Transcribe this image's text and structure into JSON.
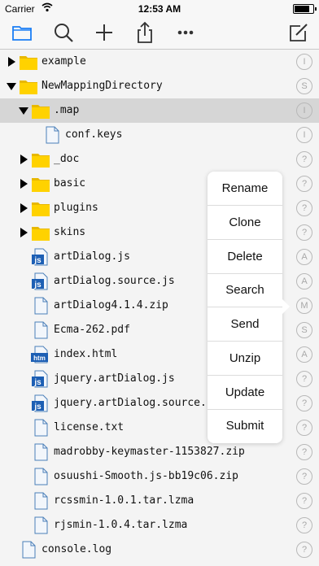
{
  "status_bar": {
    "carrier": "Carrier",
    "time": "12:53 AM",
    "battery_level": 0.9
  },
  "toolbar": {
    "buttons": [
      "folder-icon",
      "search-icon",
      "add-icon",
      "share-icon",
      "more-icon",
      "edit-icon"
    ],
    "accent_color": "#1a7ef5"
  },
  "file_tree": {
    "rows": [
      {
        "name": "example",
        "type": "folder",
        "expanded": false,
        "level": 0,
        "badge": "I"
      },
      {
        "name": "NewMappingDirectory",
        "type": "folder",
        "expanded": true,
        "level": 0,
        "badge": "S"
      },
      {
        "name": ".map",
        "type": "folder",
        "expanded": true,
        "level": 1,
        "badge": "I",
        "selected": true
      },
      {
        "name": "conf.keys",
        "type": "file",
        "level": 2,
        "badge": "I"
      },
      {
        "name": "_doc",
        "type": "folder",
        "expanded": false,
        "level": 1,
        "badge": "?"
      },
      {
        "name": "basic",
        "type": "folder",
        "expanded": false,
        "level": 1,
        "badge": "?"
      },
      {
        "name": "plugins",
        "type": "folder",
        "expanded": false,
        "level": 1,
        "badge": "?"
      },
      {
        "name": "skins",
        "type": "folder",
        "expanded": false,
        "level": 1,
        "badge": "?"
      },
      {
        "name": "artDialog.js",
        "type": "js",
        "level": 1,
        "badge": "A"
      },
      {
        "name": "artDialog.source.js",
        "type": "js",
        "level": 1,
        "badge": "A"
      },
      {
        "name": "artDialog4.1.4.zip",
        "type": "file",
        "level": 1,
        "badge": "M"
      },
      {
        "name": "Ecma-262.pdf",
        "type": "file",
        "level": 1,
        "badge": "S"
      },
      {
        "name": "index.html",
        "type": "htm",
        "level": 1,
        "badge": "A"
      },
      {
        "name": "jquery.artDialog.js",
        "type": "js",
        "level": 1,
        "badge": "?"
      },
      {
        "name": "jquery.artDialog.source.js",
        "type": "js",
        "level": 1,
        "badge": "?"
      },
      {
        "name": "license.txt",
        "type": "file",
        "level": 1,
        "badge": "?"
      },
      {
        "name": "madrobby-keymaster-1153827.zip",
        "type": "file",
        "level": 1,
        "badge": "?"
      },
      {
        "name": "osuushi-Smooth.js-bb19c06.zip",
        "type": "file",
        "level": 1,
        "badge": "?"
      },
      {
        "name": "rcssmin-1.0.1.tar.lzma",
        "type": "file",
        "level": 1,
        "badge": "?"
      },
      {
        "name": "rjsmin-1.0.4.tar.lzma",
        "type": "file",
        "level": 1,
        "badge": "?"
      },
      {
        "name": "console.log",
        "type": "file",
        "level": 0,
        "badge": "?"
      }
    ]
  },
  "context_menu": {
    "items": [
      "Rename",
      "Clone",
      "Delete",
      "Search",
      "Send",
      "Unzip",
      "Update",
      "Submit"
    ]
  }
}
